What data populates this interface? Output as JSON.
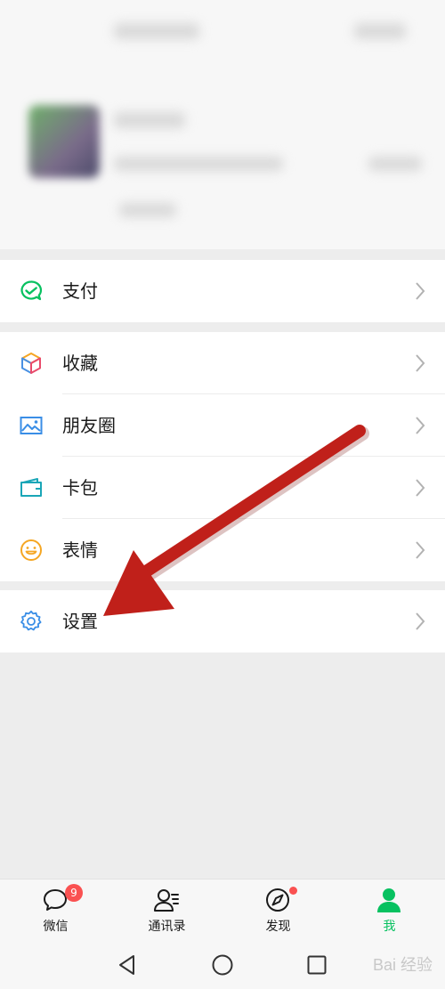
{
  "menu": {
    "pay": "支付",
    "favorites": "收藏",
    "moments": "朋友圈",
    "cards": "卡包",
    "stickers": "表情",
    "settings": "设置"
  },
  "tabbar": {
    "chats": {
      "label": "微信",
      "badge": "9"
    },
    "contacts": {
      "label": "通讯录"
    },
    "discover": {
      "label": "发现"
    },
    "me": {
      "label": "我"
    }
  },
  "colors": {
    "accent": "#07c160",
    "badge": "#fa5151",
    "annotation_arrow": "#c0201a"
  },
  "watermark": "Bai 经验"
}
